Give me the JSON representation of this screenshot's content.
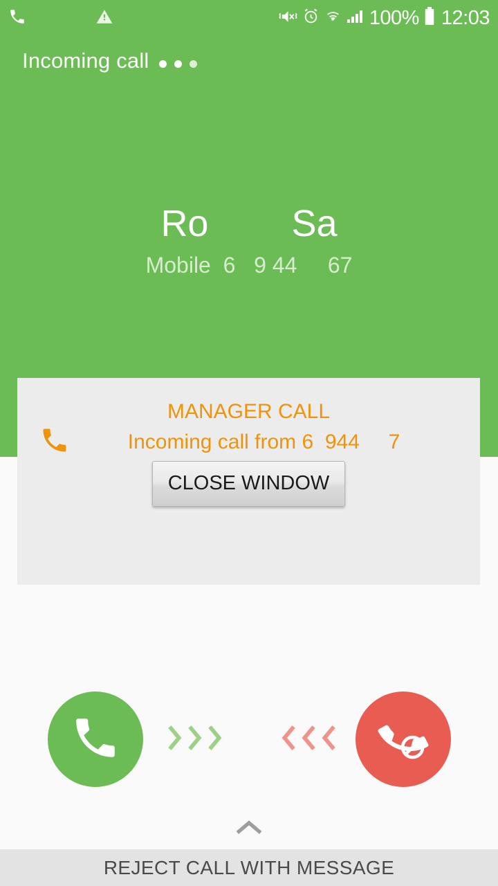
{
  "status_bar": {
    "icons": [
      "phone-handset-icon",
      "warning-triangle-icon",
      "vibrate-mute-icon",
      "alarm-clock-icon",
      "wifi-icon",
      "signal-bars-icon",
      "battery-full-icon"
    ],
    "battery_percent": "100%",
    "clock": "12:03"
  },
  "call_screen": {
    "state_label": "Incoming call",
    "contact_name": "Ro        Sa",
    "number_label": "Mobile  6   9 44     67",
    "background_color": "#6bbc54"
  },
  "dialog": {
    "title": "MANAGER CALL",
    "title_redacted_prefix": "        ",
    "message": "Incoming call from 6  944     7",
    "close_label": "CLOSE WINDOW",
    "accent_color": "#ef9309",
    "background_color": "#ececec"
  },
  "actions": {
    "answer_label": "answer-call",
    "reject_label": "reject-call",
    "answer_color": "#6bbc54",
    "reject_color": "#e85c52",
    "swipe_right_hint": ">>>",
    "swipe_left_hint": "<<<"
  },
  "bottom": {
    "handle_icon": "chevron-up-icon",
    "reject_with_message_label": "REJECT CALL WITH MESSAGE"
  }
}
